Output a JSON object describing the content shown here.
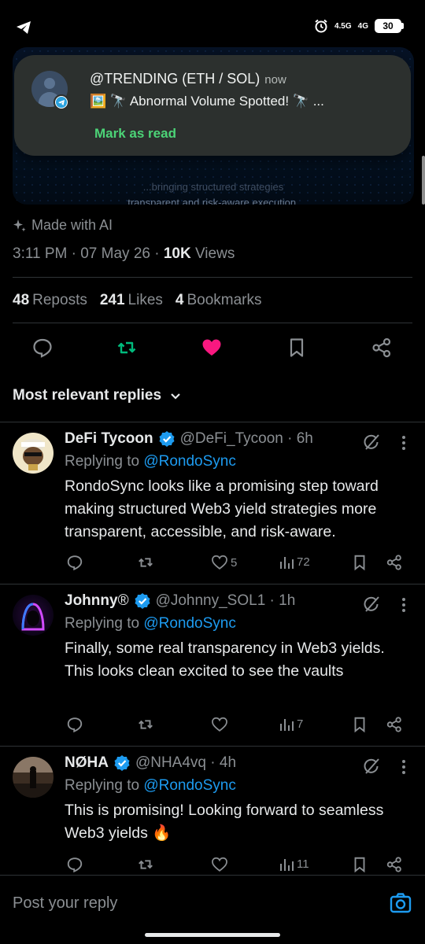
{
  "status": {
    "net1": "4.5G",
    "net2": "4G",
    "battery": "30"
  },
  "embed": {
    "ghost_line1": "...bringing structured strategies",
    "ghost_line2": "transparent and risk-aware execution."
  },
  "notification": {
    "app_icon": "telegram-icon",
    "title": "@TRENDING (ETH / SOL)",
    "time": "now",
    "message": "🖼️ 🔭 Abnormal Volume Spotted! 🔭 ...",
    "action": "Mark as read"
  },
  "post": {
    "made_with_ai": "Made with AI",
    "time": "3:11 PM · 07 May 26 · ",
    "views_count": "10K",
    "views_label": " Views",
    "reposts_count": "48",
    "reposts_label": "Reposts",
    "likes_count": "241",
    "likes_label": "Likes",
    "bookmarks_count": "4",
    "bookmarks_label": "Bookmarks",
    "colors": {
      "repost_active": "#00ba7c",
      "like_active": "#f91880",
      "link": "#1d9bf0"
    }
  },
  "sort": {
    "label": "Most relevant replies"
  },
  "replies": [
    {
      "name": "DeFi Tycoon",
      "handle": "@DeFi_Tycoon · 6h",
      "replying_prefix": "Replying to ",
      "mention": "@RondoSync",
      "text": "RondoSync looks like a promising step toward making structured Web3 yield strategies more transparent, accessible, and risk-aware.",
      "likes": "5",
      "views": "72"
    },
    {
      "name": "Johnny",
      "name_suffix": "®",
      "handle": "@Johnny_SOL1 · 1h",
      "replying_prefix": "Replying to ",
      "mention": "@RondoSync",
      "text": "Finally, some real transparency in Web3 yields. This looks clean  excited to see the vaults",
      "likes": "",
      "views": "7"
    },
    {
      "name": "NØHA",
      "handle": "@NHA4vq · 4h",
      "replying_prefix": "Replying to ",
      "mention": "@RondoSync",
      "text": "This is promising! Looking forward to seamless Web3 yields 🔥",
      "likes": "",
      "views": "11"
    }
  ],
  "composer": {
    "placeholder": "Post your reply"
  }
}
